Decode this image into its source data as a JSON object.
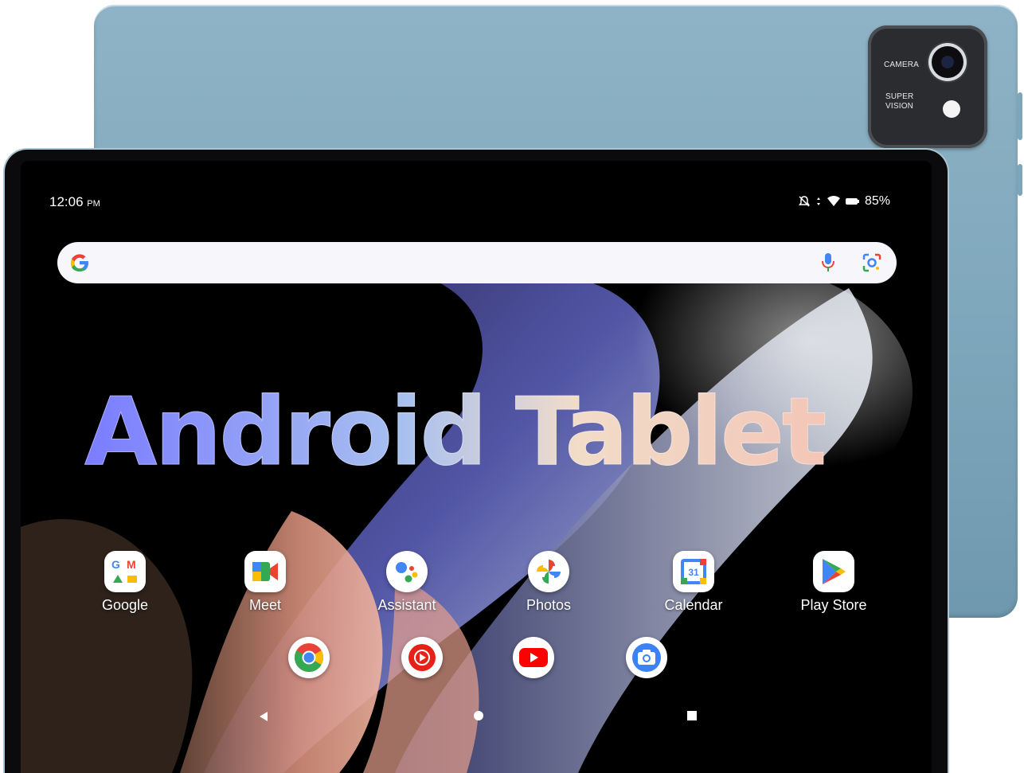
{
  "device": {
    "camera_module": {
      "label_top": "CAMERA",
      "label_bottom_line1": "SUPER",
      "label_bottom_line2": "VISION"
    }
  },
  "status_bar": {
    "time": "12:06",
    "ampm": "PM",
    "battery": "85%",
    "icons": [
      "notifications-off-icon",
      "signal-icon",
      "wifi-icon",
      "battery-icon"
    ]
  },
  "search_bar": {
    "icons": [
      "google-g-icon",
      "mic-icon",
      "lens-icon"
    ]
  },
  "headline": "Android Tablet",
  "apps": [
    {
      "label": "Google",
      "icon": "google-folder-icon"
    },
    {
      "label": "Meet",
      "icon": "meet-icon"
    },
    {
      "label": "Assistant",
      "icon": "assistant-icon"
    },
    {
      "label": "Photos",
      "icon": "photos-icon"
    },
    {
      "label": "Calendar",
      "icon": "calendar-icon",
      "icon_text": "31"
    },
    {
      "label": "Play Store",
      "icon": "play-store-icon"
    }
  ],
  "dock": [
    {
      "icon": "chrome-icon"
    },
    {
      "icon": "youtube-music-icon"
    },
    {
      "icon": "youtube-icon"
    },
    {
      "icon": "camera-icon"
    }
  ],
  "navigation": [
    "back-icon",
    "home-icon",
    "recents-icon"
  ],
  "colors": {
    "tablet_body": "#7ea6bb",
    "bezel": "#0b0b0d",
    "search_bar": "#f7f7fb",
    "google_blue": "#4285f4",
    "google_red": "#ea4335",
    "google_yellow": "#fbbc04",
    "google_green": "#34a853"
  }
}
